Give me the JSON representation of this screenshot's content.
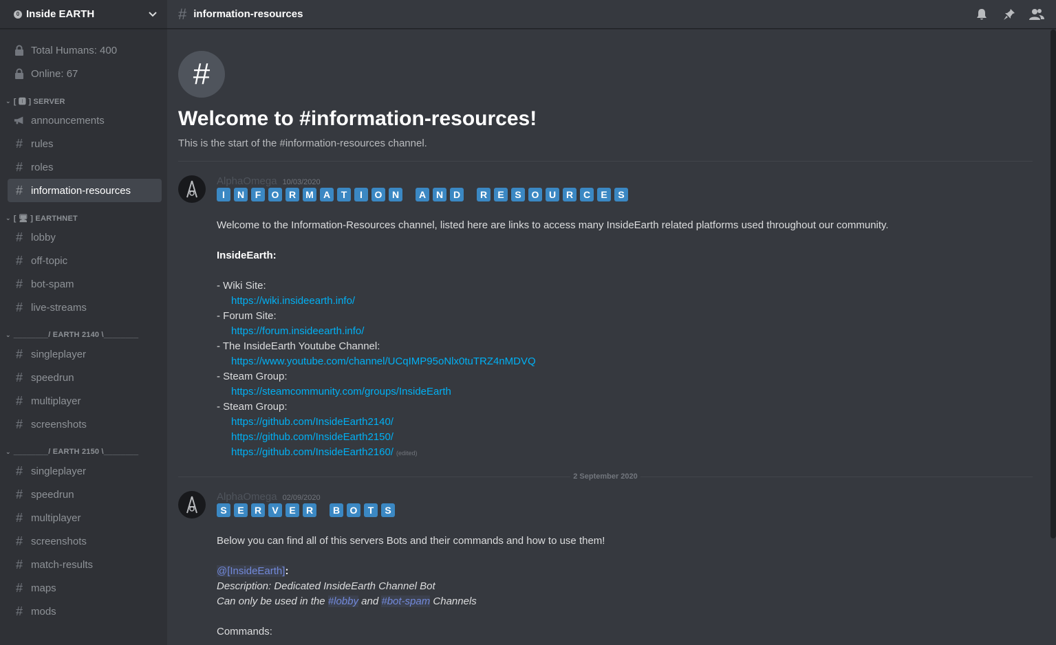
{
  "server": {
    "badge": "0",
    "name": "Inside EARTH"
  },
  "sidebar": {
    "info_channels": [
      {
        "label": "Total Humans: 400",
        "icon": "lock-icon"
      },
      {
        "label": "Online: 67",
        "icon": "lock-icon"
      }
    ],
    "categories": [
      {
        "label": "[ 🅸 ] SERVER",
        "channels": [
          {
            "label": "announcements",
            "icon": "megaphone-icon",
            "active": false
          },
          {
            "label": "rules",
            "icon": "hash-icon",
            "active": false
          },
          {
            "label": "roles",
            "icon": "hash-icon",
            "active": false
          },
          {
            "label": "information-resources",
            "icon": "hash-icon",
            "active": true
          }
        ]
      },
      {
        "label": "[ 🖥 ] EARTHNET",
        "channels": [
          {
            "label": "lobby",
            "icon": "hash-icon",
            "active": false
          },
          {
            "label": "off-topic",
            "icon": "hash-icon",
            "active": false
          },
          {
            "label": "bot-spam",
            "icon": "hash-icon",
            "active": false
          },
          {
            "label": "live-streams",
            "icon": "hash-icon",
            "active": false
          }
        ]
      },
      {
        "label": "________/ EARTH 2140 \\________",
        "channels": [
          {
            "label": "singleplayer",
            "icon": "hash-icon",
            "active": false
          },
          {
            "label": "speedrun",
            "icon": "hash-icon",
            "active": false
          },
          {
            "label": "multiplayer",
            "icon": "hash-icon",
            "active": false
          },
          {
            "label": "screenshots",
            "icon": "hash-icon",
            "active": false
          }
        ]
      },
      {
        "label": "________/ EARTH 2150 \\________",
        "channels": [
          {
            "label": "singleplayer",
            "icon": "hash-icon",
            "active": false
          },
          {
            "label": "speedrun",
            "icon": "hash-icon",
            "active": false
          },
          {
            "label": "multiplayer",
            "icon": "hash-icon",
            "active": false
          },
          {
            "label": "screenshots",
            "icon": "hash-icon",
            "active": false
          },
          {
            "label": "match-results",
            "icon": "hash-icon",
            "active": false
          },
          {
            "label": "maps",
            "icon": "hash-icon",
            "active": false
          },
          {
            "label": "mods",
            "icon": "hash-icon",
            "active": false
          }
        ]
      }
    ]
  },
  "header": {
    "channel_name": "information-resources",
    "icons": [
      "bell-icon",
      "pin-icon",
      "members-icon"
    ]
  },
  "welcome": {
    "title": "Welcome to #information-resources!",
    "subtitle": "This is the start of the #information-resources channel."
  },
  "messages": [
    {
      "author": "AlphaOmega",
      "timestamp": "10/03/2020",
      "banner_words": [
        "INFORMATION",
        "AND",
        "RESOURCES"
      ],
      "lines": [
        {
          "type": "text",
          "text": "Welcome to the Information-Resources channel, listed here are links to access many InsideEarth related platforms used throughout our community."
        },
        {
          "type": "blank"
        },
        {
          "type": "bold",
          "text": "InsideEarth:"
        },
        {
          "type": "blank"
        },
        {
          "type": "text",
          "text": "- Wiki Site:"
        },
        {
          "type": "link",
          "text": "https://wiki.insideearth.info/"
        },
        {
          "type": "text",
          "text": "- Forum Site:"
        },
        {
          "type": "link",
          "text": "https://forum.insideearth.info/"
        },
        {
          "type": "text",
          "text": "- The InsideEarth Youtube Channel:"
        },
        {
          "type": "link",
          "text": "https://www.youtube.com/channel/UCqIMP95oNlx0tuTRZ4nMDVQ"
        },
        {
          "type": "text",
          "text": "- Steam Group:"
        },
        {
          "type": "link",
          "text": "https://steamcommunity.com/groups/InsideEarth"
        },
        {
          "type": "text",
          "text": "- Steam Group:"
        },
        {
          "type": "link",
          "text": "https://github.com/InsideEarth2140/"
        },
        {
          "type": "link",
          "text": "https://github.com/InsideEarth2150/"
        },
        {
          "type": "link",
          "text": "https://github.com/InsideEarth2160/",
          "edited": "(edited)"
        }
      ]
    },
    {
      "author": "AlphaOmega",
      "timestamp": "02/09/2020",
      "banner_words": [
        "SERVER",
        "BOTS"
      ],
      "lines": [
        {
          "type": "text",
          "text": "Below you can find all of this servers Bots and their commands and how to use them!"
        },
        {
          "type": "blank"
        },
        {
          "type": "mention_line",
          "mention": "@[InsideEarth]",
          "suffix": ":"
        },
        {
          "type": "italic",
          "text": "Description: Dedicated InsideEarth Channel Bot"
        },
        {
          "type": "channels_line",
          "prefix": "Can only be used in the ",
          "ch1": "#lobby",
          "mid": " and ",
          "ch2": "#bot-spam",
          "suffix": " Channels"
        },
        {
          "type": "blank"
        },
        {
          "type": "text",
          "text": "Commands:"
        }
      ]
    }
  ],
  "date_separator": "2 September 2020",
  "colors": {
    "sidebar_bg": "#2f3136",
    "main_bg": "#36393f",
    "link": "#00b0f4",
    "emoji_tile": "#3b88c3",
    "mention": "#7289da"
  }
}
